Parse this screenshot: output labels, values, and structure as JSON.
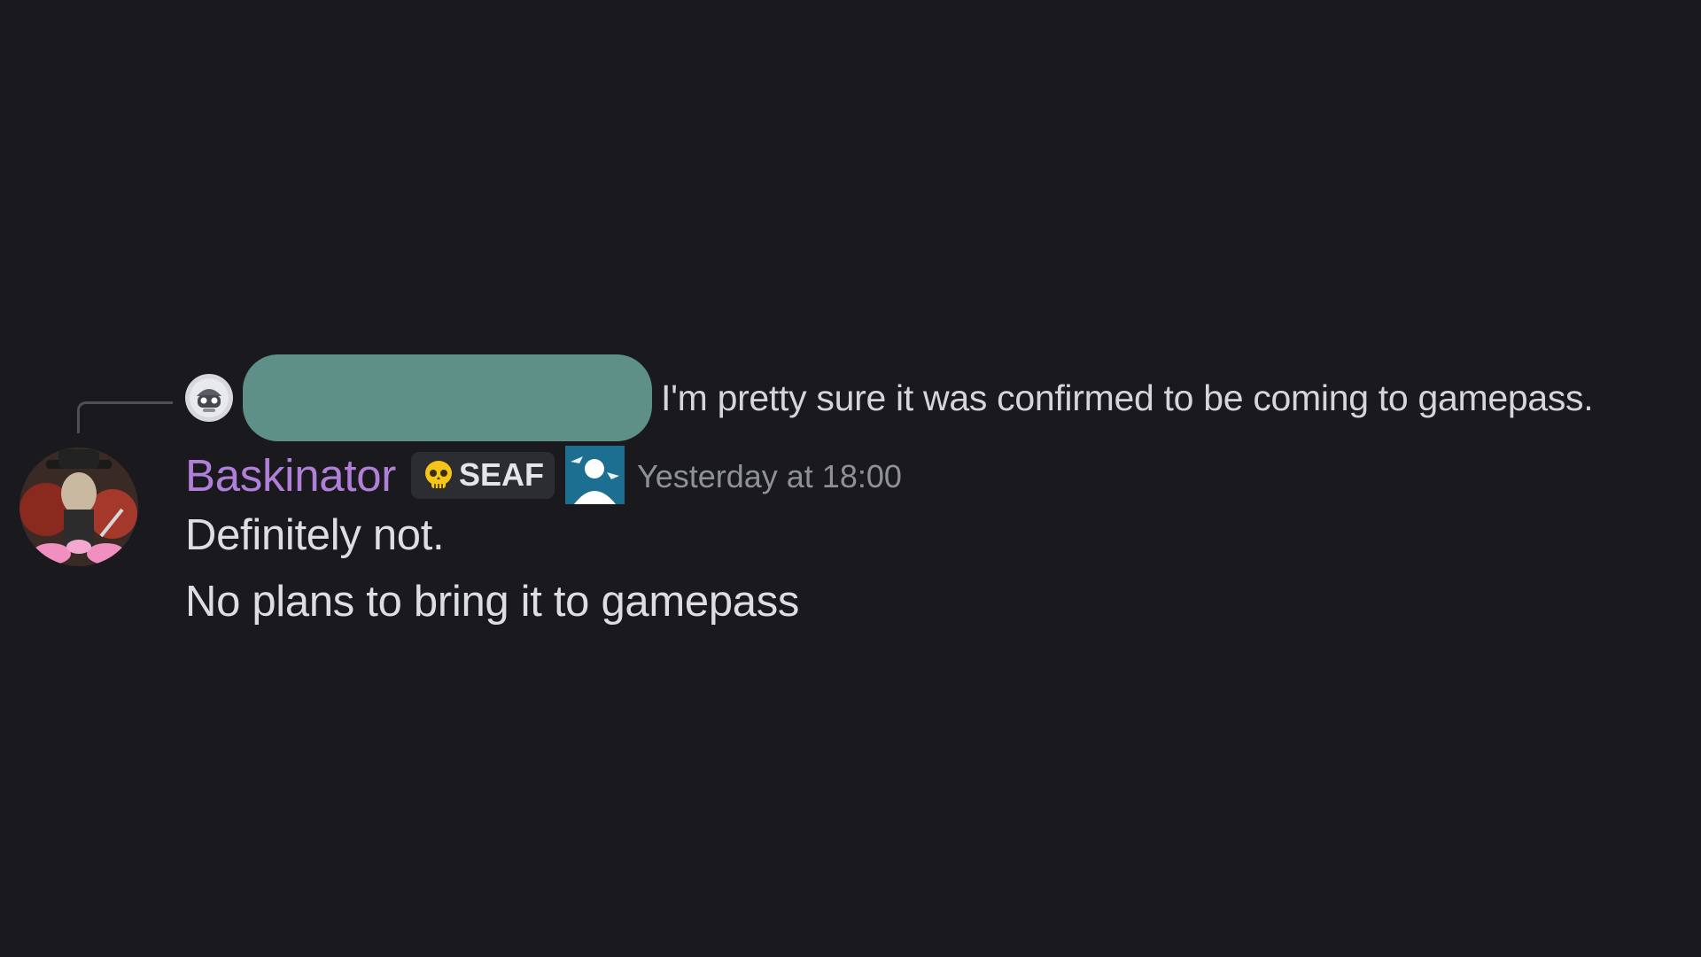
{
  "reply": {
    "author_hidden": true,
    "text": "I'm pretty sure it was confirmed to be coming to gamepass."
  },
  "message": {
    "username": "Baskinator",
    "role_tag": "SEAF",
    "timestamp": "Yesterday at 18:00",
    "lines": [
      "Definitely not.",
      "No plans to bring it to gamepass"
    ]
  },
  "colors": {
    "background": "#1a1a1e",
    "username": "#b07fd8",
    "redaction_box": "#5f9088",
    "role_icon": "#1c6f91"
  },
  "icons": {
    "reply_avatar": "robot-avatar-icon",
    "role_tag_icon": "skull-icon",
    "role_icon": "soldier-role-icon"
  }
}
